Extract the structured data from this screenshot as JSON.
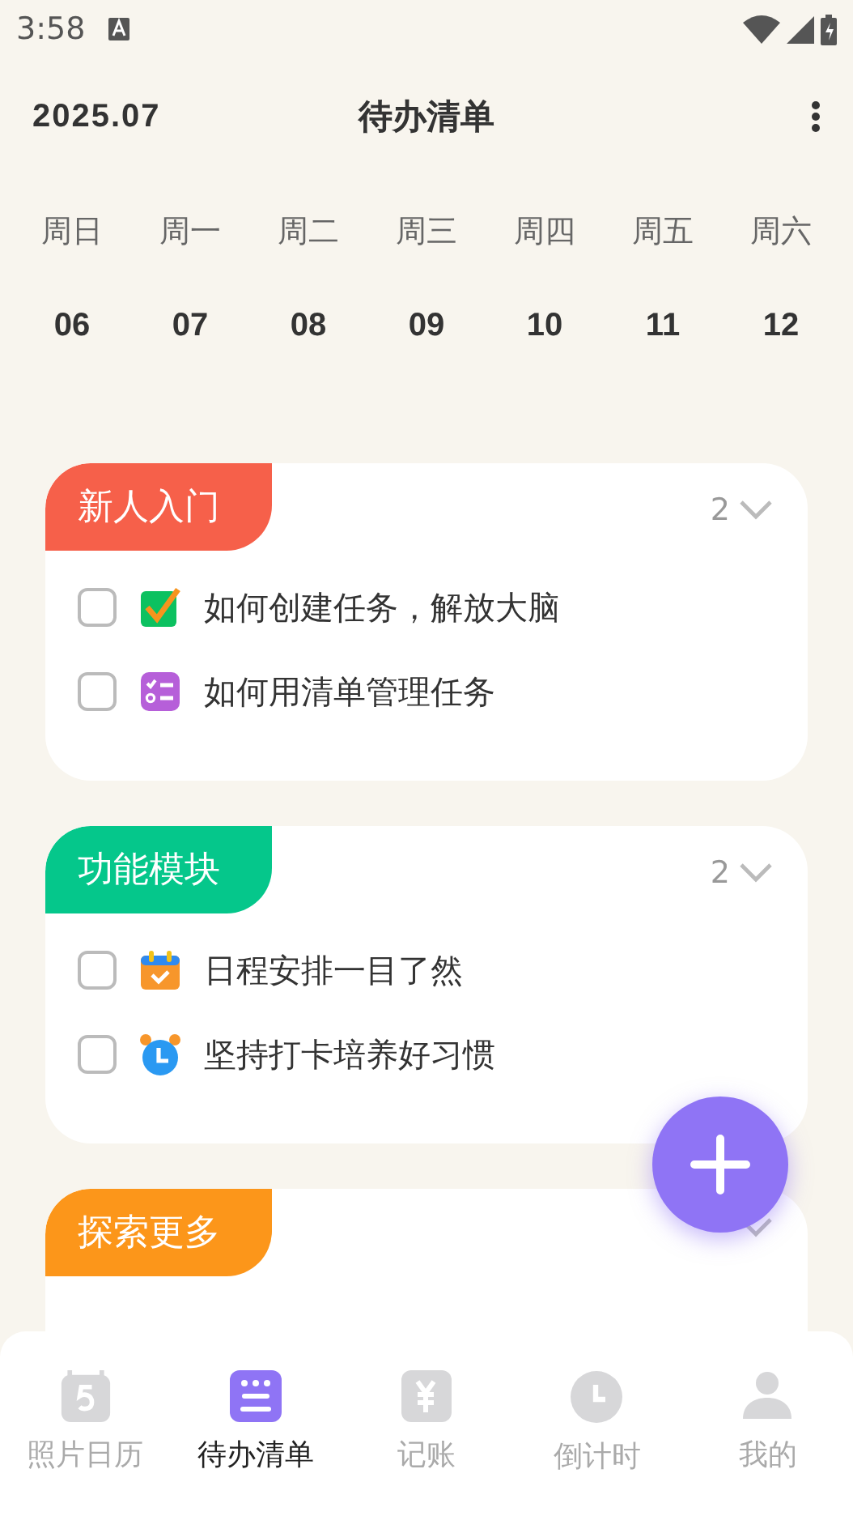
{
  "status_bar": {
    "time": "3:58"
  },
  "header": {
    "month": "2025.07",
    "title": "待办清单"
  },
  "week": [
    {
      "weekday": "周日",
      "date": "06"
    },
    {
      "weekday": "周一",
      "date": "07"
    },
    {
      "weekday": "周二",
      "date": "08"
    },
    {
      "weekday": "周三",
      "date": "09"
    },
    {
      "weekday": "周四",
      "date": "10"
    },
    {
      "weekday": "周五",
      "date": "11"
    },
    {
      "weekday": "周六",
      "date": "12"
    }
  ],
  "groups": [
    {
      "title": "新人入门",
      "color": "#f6604a",
      "count": "2",
      "items": [
        {
          "kind": "check",
          "text": "如何创建任务，解放大脑",
          "checked": false
        },
        {
          "kind": "list",
          "text": "如何用清单管理任务",
          "checked": false
        }
      ]
    },
    {
      "title": "功能模块",
      "color": "#05c78b",
      "count": "2",
      "items": [
        {
          "kind": "calendar",
          "text": "日程安排一目了然",
          "checked": false
        },
        {
          "kind": "alarm",
          "text": "坚持打卡培养好习惯",
          "checked": false
        }
      ]
    },
    {
      "title": "探索更多",
      "color": "#fc961a"
    }
  ],
  "nav": [
    {
      "kind": "photo",
      "label": "照片日历",
      "selected": false
    },
    {
      "kind": "todo",
      "label": "待办清单",
      "selected": true
    },
    {
      "kind": "ledger",
      "label": "记账",
      "selected": false
    },
    {
      "kind": "clock",
      "label": "倒计时",
      "selected": false
    },
    {
      "kind": "person",
      "label": "我的",
      "selected": false
    }
  ]
}
